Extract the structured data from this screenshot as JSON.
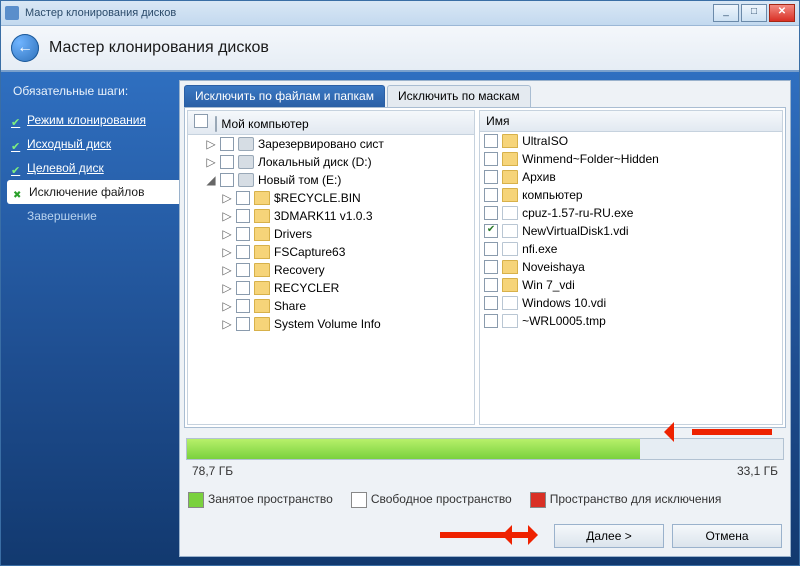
{
  "window": {
    "title": "Мастер клонирования дисков"
  },
  "header": {
    "title": "Мастер клонирования дисков"
  },
  "sidebar": {
    "heading": "Обязательные шаги:",
    "steps": [
      {
        "label": "Режим клонирования",
        "state": "done"
      },
      {
        "label": "Исходный диск",
        "state": "done"
      },
      {
        "label": "Целевой диск",
        "state": "done"
      },
      {
        "label": "Исключение файлов",
        "state": "current"
      },
      {
        "label": "Завершение",
        "state": "pending"
      }
    ]
  },
  "tabs": {
    "active": "Исключить по файлам и папкам",
    "other": "Исключить по маскам"
  },
  "tree": {
    "header": "Мой компьютер",
    "items": [
      {
        "label": "Зарезервировано сист",
        "icon": "drive",
        "indent": 1,
        "exp": "▷",
        "chk": false
      },
      {
        "label": "Локальный диск (D:)",
        "icon": "drive",
        "indent": 1,
        "exp": "▷",
        "chk": false
      },
      {
        "label": "Новый том (E:)",
        "icon": "drive",
        "indent": 1,
        "exp": "◢",
        "chk": false
      },
      {
        "label": "$RECYCLE.BIN",
        "icon": "folder",
        "indent": 2,
        "exp": "▷",
        "chk": false
      },
      {
        "label": "3DMARK11 v1.0.3",
        "icon": "folder",
        "indent": 2,
        "exp": "▷",
        "chk": false
      },
      {
        "label": "Drivers",
        "icon": "folder",
        "indent": 2,
        "exp": "▷",
        "chk": false
      },
      {
        "label": "FSCapture63",
        "icon": "folder",
        "indent": 2,
        "exp": "▷",
        "chk": false
      },
      {
        "label": "Recovery",
        "icon": "folder",
        "indent": 2,
        "exp": "▷",
        "chk": false
      },
      {
        "label": "RECYCLER",
        "icon": "folder",
        "indent": 2,
        "exp": "▷",
        "chk": false
      },
      {
        "label": "Share",
        "icon": "folder",
        "indent": 2,
        "exp": "▷",
        "chk": false
      },
      {
        "label": "System Volume Info",
        "icon": "folder",
        "indent": 2,
        "exp": "▷",
        "chk": false
      }
    ]
  },
  "list": {
    "header": "Имя",
    "items": [
      {
        "label": "UltraISO",
        "icon": "folder",
        "chk": false
      },
      {
        "label": "Winmend~Folder~Hidden",
        "icon": "folder",
        "chk": false
      },
      {
        "label": "Архив",
        "icon": "folder",
        "chk": false
      },
      {
        "label": "компьютер",
        "icon": "folder",
        "chk": false
      },
      {
        "label": "cpuz-1.57-ru-RU.exe",
        "icon": "file",
        "chk": false
      },
      {
        "label": "NewVirtualDisk1.vdi",
        "icon": "file",
        "chk": true
      },
      {
        "label": "nfi.exe",
        "icon": "file",
        "chk": false
      },
      {
        "label": "Noveishaya",
        "icon": "folder",
        "chk": false
      },
      {
        "label": "Win 7_vdi",
        "icon": "folder",
        "chk": false
      },
      {
        "label": "Windows 10.vdi",
        "icon": "file",
        "chk": false
      },
      {
        "label": "~WRL0005.tmp",
        "icon": "file",
        "chk": false
      }
    ]
  },
  "usage": {
    "used_label": "78,7 ГБ",
    "free_label": "33,1 ГБ",
    "fill_percent": 76
  },
  "legend": {
    "used": "Занятое пространство",
    "free": "Свободное пространство",
    "excl": "Пространство для исключения"
  },
  "footer": {
    "next": "Далее >",
    "cancel": "Отмена"
  }
}
